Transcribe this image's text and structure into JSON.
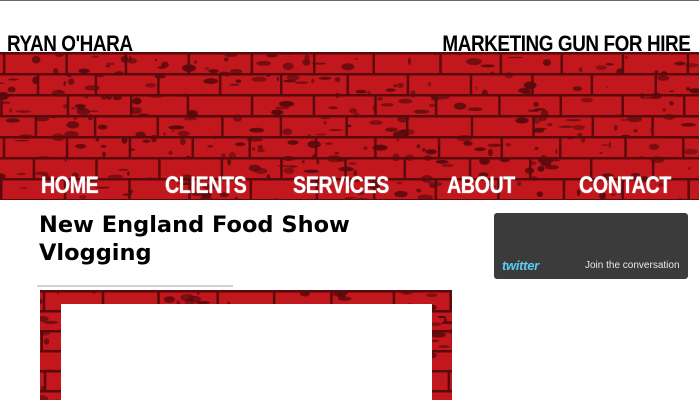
{
  "header": {
    "site_title": "RYAN O'HARA",
    "tagline": "MARKETING GUN FOR HIRE"
  },
  "nav": {
    "items": [
      {
        "label": "HOME"
      },
      {
        "label": "CLIENTS"
      },
      {
        "label": "SERVICES"
      },
      {
        "label": "ABOUT"
      },
      {
        "label": "CONTACT"
      }
    ]
  },
  "post": {
    "title": "New England Food Show Vlogging"
  },
  "sidebar": {
    "twitter": {
      "logo": "twitter",
      "cta": "Join the conversation"
    }
  },
  "colors": {
    "brick_red": "#c3171e",
    "mortar_dark": "#5a0a0c",
    "twitter_bg": "#3b3b3b",
    "twitter_blue": "#5ecbf4"
  }
}
